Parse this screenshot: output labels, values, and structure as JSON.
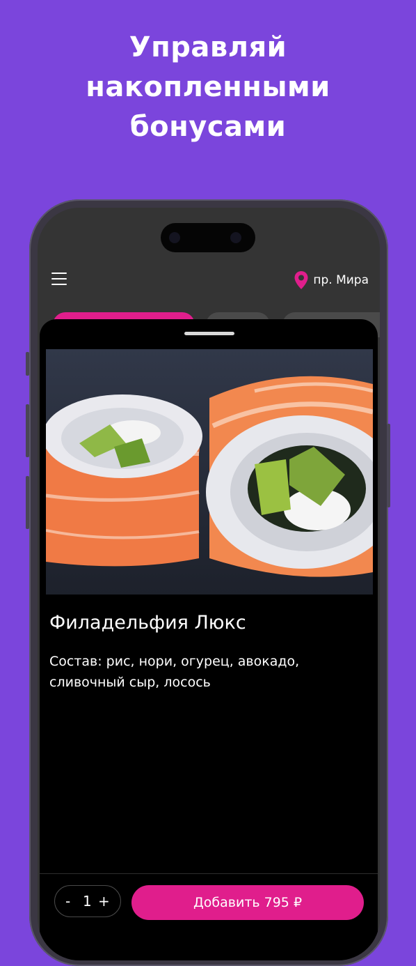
{
  "promo": {
    "headline_line1": "Управляй",
    "headline_line2": "накопленными",
    "headline_line3": "бонусами"
  },
  "header": {
    "menu_icon": "hamburger-menu-icon",
    "location_icon": "map-pin-icon",
    "location_label": "пр. Мира"
  },
  "product": {
    "image": "philadelphia-lux-roll-photo",
    "title": "Филадельфия Люкс",
    "composition": "Состав: рис, нори, огурец, авокадо, сливочный сыр, лосось"
  },
  "cart": {
    "minus": "-",
    "quantity": "1",
    "plus": "+",
    "add_label": "Добавить 795 ₽"
  },
  "colors": {
    "background": "#7b45dc",
    "accent": "#e01e8c",
    "sheet": "#000000"
  }
}
